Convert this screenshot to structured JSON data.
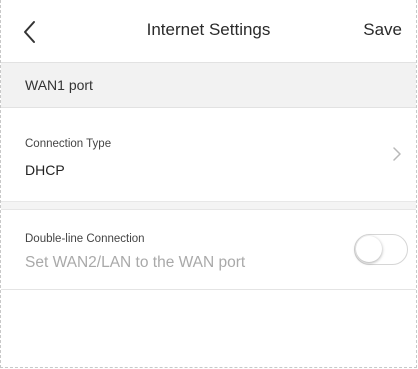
{
  "header": {
    "title": "Internet Settings",
    "save_label": "Save",
    "back_icon": "chevron-left-icon"
  },
  "section": {
    "title": "WAN1 port"
  },
  "connection_type": {
    "label": "Connection Type",
    "value": "DHCP",
    "chevron_icon": "chevron-right-icon"
  },
  "double_line": {
    "label": "Double-line Connection",
    "description": "Set WAN2/LAN to the WAN port",
    "enabled": false
  },
  "colors": {
    "section_bg": "#f2f2f2",
    "muted_text": "#a9a9a9",
    "toggle_border": "#d6d6d6"
  }
}
